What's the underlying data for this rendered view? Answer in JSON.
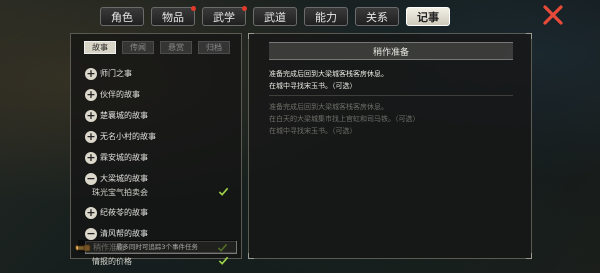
{
  "top_tabs": [
    {
      "label": "角色",
      "active": false,
      "dot": false
    },
    {
      "label": "物品",
      "active": false,
      "dot": true
    },
    {
      "label": "武学",
      "active": false,
      "dot": true
    },
    {
      "label": "武道",
      "active": false,
      "dot": false
    },
    {
      "label": "能力",
      "active": false,
      "dot": false
    },
    {
      "label": "关系",
      "active": false,
      "dot": false
    },
    {
      "label": "记事",
      "active": true,
      "dot": false
    }
  ],
  "sub_tabs": [
    {
      "label": "故事",
      "active": true
    },
    {
      "label": "传闻",
      "active": false
    },
    {
      "label": "悬赏",
      "active": false
    },
    {
      "label": "归档",
      "active": false
    }
  ],
  "story_list": [
    {
      "label": "师门之事",
      "expanded": false
    },
    {
      "label": "伙伴的故事",
      "expanded": false
    },
    {
      "label": "楚襄城的故事",
      "expanded": false
    },
    {
      "label": "无名小村的故事",
      "expanded": false
    },
    {
      "label": "霖安城的故事",
      "expanded": false
    },
    {
      "label": "大梁城的故事",
      "expanded": true,
      "children": [
        {
          "label": "珠光宝气拍卖会",
          "checked": true
        }
      ]
    },
    {
      "label": "纪莜苓的故事",
      "expanded": false
    },
    {
      "label": "清风帮的故事",
      "expanded": true,
      "children": [
        {
          "label": "稍作准备",
          "checked": true,
          "selected": true
        },
        {
          "label": "情报的价格",
          "checked": true
        }
      ]
    }
  ],
  "footer_note": "最多同时可追踪3个事件任务",
  "detail": {
    "title": "稍作准备",
    "current_lines": [
      "准备完成后回到大梁城客栈客房休息。",
      "在城中寻找宋玉书。（可选）"
    ],
    "done_lines": [
      "准备完成后回到大梁城客栈客房休息。",
      "在白天的大梁城集市找上官虹和司马铁。（可选）",
      "在城中寻找宋玉书。（可选）"
    ]
  },
  "colors": {
    "accent_check": "#9ed24a",
    "active_tab": "#e9e5d9",
    "notify_dot": "#e23a2a"
  }
}
